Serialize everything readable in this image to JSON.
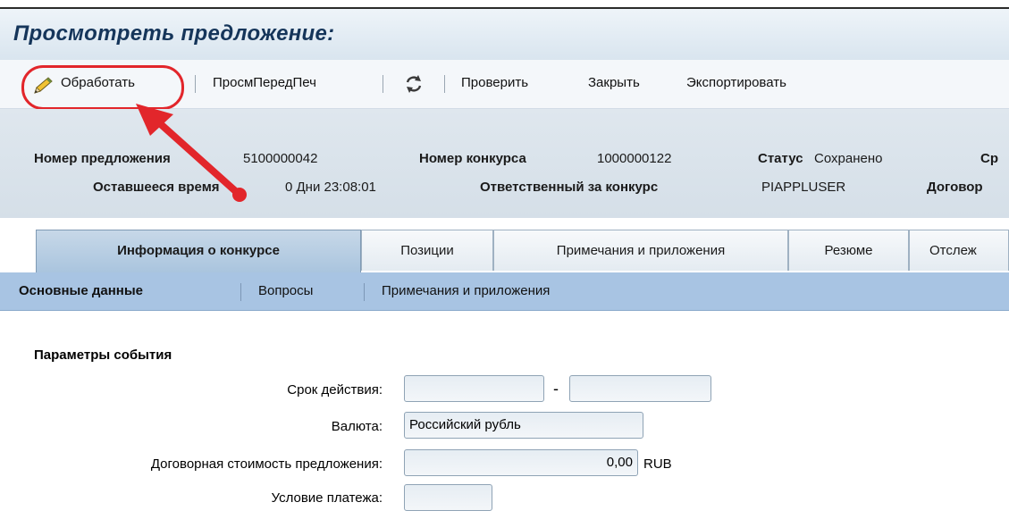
{
  "page_title": "Просмотреть предложение:",
  "toolbar": {
    "edit_label": "Обработать",
    "preview_label": "ПросмПередПеч",
    "check_label": "Проверить",
    "close_label": "Закрыть",
    "export_label": "Экспортировать"
  },
  "header": {
    "bid_number_label": "Номер предложения",
    "bid_number": "5100000042",
    "event_number_label": "Номер конкурса",
    "event_number": "1000000122",
    "status_label": "Статус",
    "status_value": "Сохранено",
    "cut_label_1": "Ср",
    "remaining_label": "Оставшееся время",
    "remaining_value": "0 Дни 23:08:01",
    "responsible_label": "Ответственный за конкурс",
    "responsible_value": "PIAPPLUSER",
    "cut_label_2": "Договор"
  },
  "tabs": [
    {
      "label": "Информация о конкурсе"
    },
    {
      "label": "Позиции"
    },
    {
      "label": "Примечания и приложения"
    },
    {
      "label": "Резюме"
    },
    {
      "label": "Отслеж"
    }
  ],
  "subnav": [
    {
      "label": "Основные данные"
    },
    {
      "label": "Вопросы"
    },
    {
      "label": "Примечания и приложения"
    }
  ],
  "section": {
    "title": "Параметры события",
    "validity_label": "Срок действия:",
    "validity_from": "",
    "validity_to": "",
    "validity_dash": "-",
    "currency_label": "Валюта:",
    "currency_value": "Российский рубль",
    "price_label": "Договорная стоимость предложения:",
    "price_value": "0,00",
    "price_unit": "RUB",
    "payment_label": "Условие платежа:",
    "payment_value": ""
  },
  "colors": {
    "title": "#15355a",
    "subnav_bg": "#a8c4e3",
    "active_tab": "#a9c4de",
    "annotation": "#e2262b"
  },
  "icons": [
    "pencil-icon",
    "refresh-icon"
  ]
}
